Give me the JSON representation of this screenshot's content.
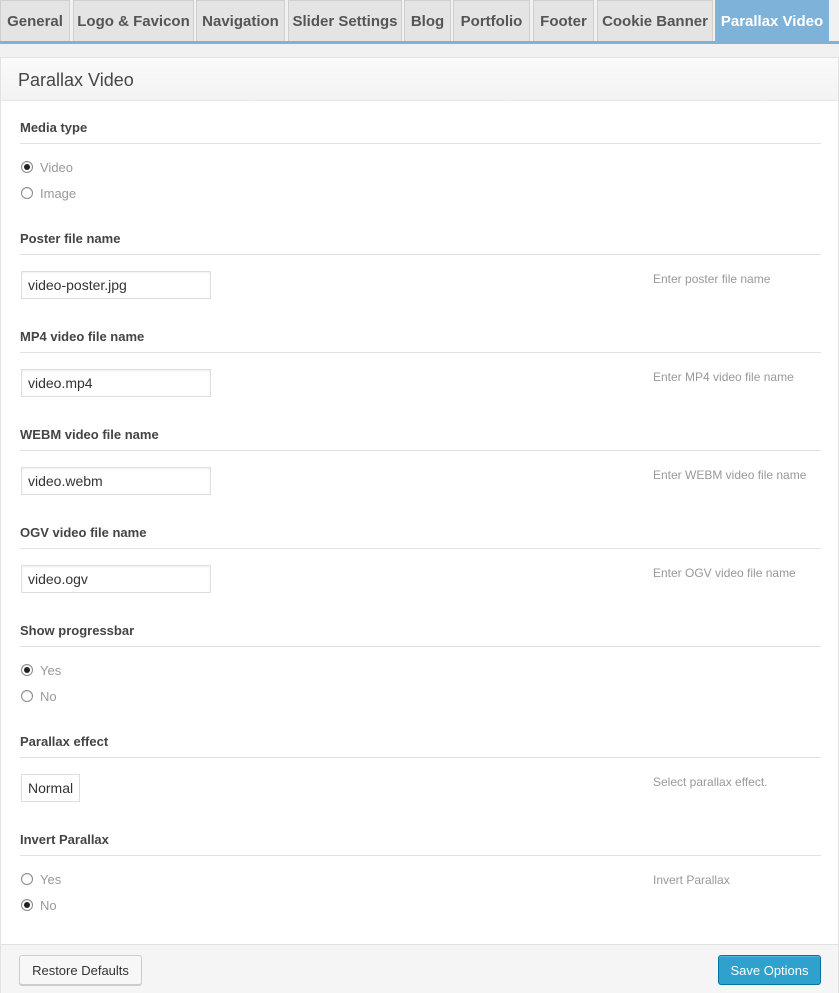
{
  "tabs": [
    {
      "label": "General"
    },
    {
      "label": "Logo & Favicon"
    },
    {
      "label": "Navigation"
    },
    {
      "label": "Slider Settings"
    },
    {
      "label": "Blog"
    },
    {
      "label": "Portfolio"
    },
    {
      "label": "Footer"
    },
    {
      "label": "Cookie Banner"
    },
    {
      "label": "Parallax Video",
      "active": true
    }
  ],
  "panel": {
    "title": "Parallax Video"
  },
  "media_type": {
    "label": "Media type",
    "options": [
      {
        "label": "Video",
        "checked": true
      },
      {
        "label": "Image",
        "checked": false
      }
    ]
  },
  "poster": {
    "label": "Poster file name",
    "value": "video-poster.jpg",
    "help": "Enter poster file name"
  },
  "mp4": {
    "label": "MP4 video file name",
    "value": "video.mp4",
    "help": "Enter MP4 video file name"
  },
  "webm": {
    "label": "WEBM video file name",
    "value": "video.webm",
    "help": "Enter WEBM video file name"
  },
  "ogv": {
    "label": "OGV video file name",
    "value": "video.ogv",
    "help": "Enter OGV video file name"
  },
  "progressbar": {
    "label": "Show progressbar",
    "options": [
      {
        "label": "Yes",
        "checked": true
      },
      {
        "label": "No",
        "checked": false
      }
    ]
  },
  "parallax_effect": {
    "label": "Parallax effect",
    "value": "Normal",
    "help": "Select parallax effect."
  },
  "invert_parallax": {
    "label": "Invert Parallax",
    "help": "Invert Parallax",
    "options": [
      {
        "label": "Yes",
        "checked": false
      },
      {
        "label": "No",
        "checked": true
      }
    ]
  },
  "footer": {
    "restore_label": "Restore Defaults",
    "save_label": "Save Options"
  },
  "colors": {
    "accent": "#7fb2d9",
    "primary_button": "#2ea2cc"
  }
}
